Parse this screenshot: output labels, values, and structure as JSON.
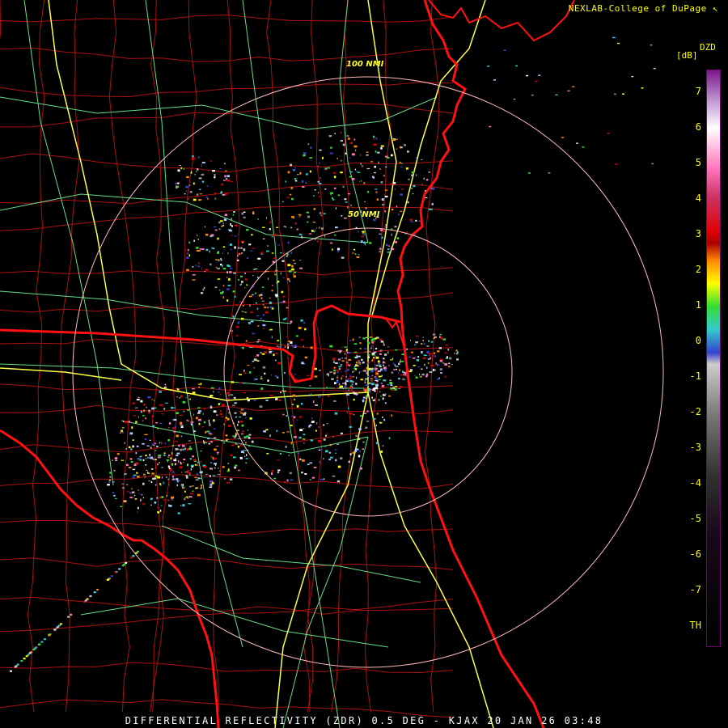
{
  "credit": "NEXLAB-College of DuPage",
  "credit_mark": "↖",
  "product_title": "DIFFERENTIAL REFLECTIVITY (ZDR) 0.5 DEG - KJAX 20 JAN 26 03:48",
  "colorbar": {
    "title": "DZD",
    "unit": "[dB]",
    "labels": [
      "7",
      "6",
      "5",
      "4",
      "3",
      "2",
      "1",
      "0",
      "-1",
      "-2",
      "-3",
      "-4",
      "-5",
      "-6",
      "-7",
      "TH"
    ],
    "colors": {
      "top": "#7a1a8a",
      "high": "#ffffff",
      "pink": "#ff77bb",
      "red": "#e00000",
      "orange": "#ff8800",
      "yellow": "#ffff00",
      "green": "#33dd33",
      "cyan": "#33cccc",
      "blue": "#3344cc",
      "gray": "#cccccc",
      "dark": "#1a0a1a"
    }
  },
  "rings": [
    {
      "label": "50 NMI"
    },
    {
      "label": "100 NMI"
    }
  ],
  "map_colors": {
    "state_borders": "#ff1111",
    "county_borders": "#aa1111",
    "highways": "#ffff44",
    "roads": "#66dd88",
    "rings": "#ffbbbb",
    "coastline": "#ff1111"
  }
}
